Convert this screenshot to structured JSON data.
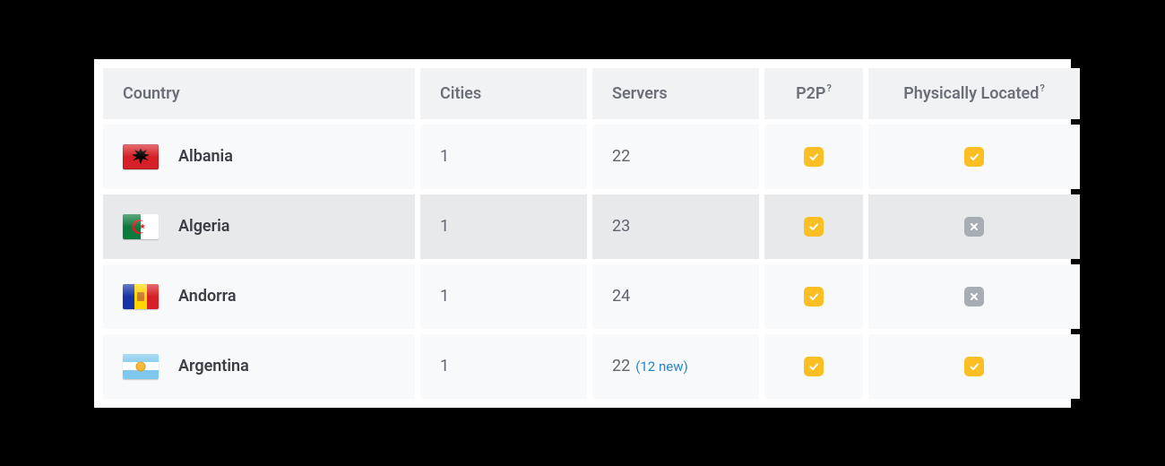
{
  "columns": {
    "country": "Country",
    "cities": "Cities",
    "servers": "Servers",
    "p2p": "P2P",
    "physically_located": "Physically Located",
    "help_sup": "?"
  },
  "rows": [
    {
      "country": "Albania",
      "flag": "albania",
      "cities": "1",
      "servers": "22",
      "servers_new": "",
      "p2p": true,
      "physically_located": true
    },
    {
      "country": "Algeria",
      "flag": "algeria",
      "cities": "1",
      "servers": "23",
      "servers_new": "",
      "p2p": true,
      "physically_located": false
    },
    {
      "country": "Andorra",
      "flag": "andorra",
      "cities": "1",
      "servers": "24",
      "servers_new": "",
      "p2p": true,
      "physically_located": false
    },
    {
      "country": "Argentina",
      "flag": "argentina",
      "cities": "1",
      "servers": "22",
      "servers_new": "(12 new)",
      "p2p": true,
      "physically_located": true
    }
  ],
  "colors": {
    "badge_yes": "#fbbf24",
    "badge_no": "#a8adb3",
    "new_label": "#1f86c7"
  }
}
